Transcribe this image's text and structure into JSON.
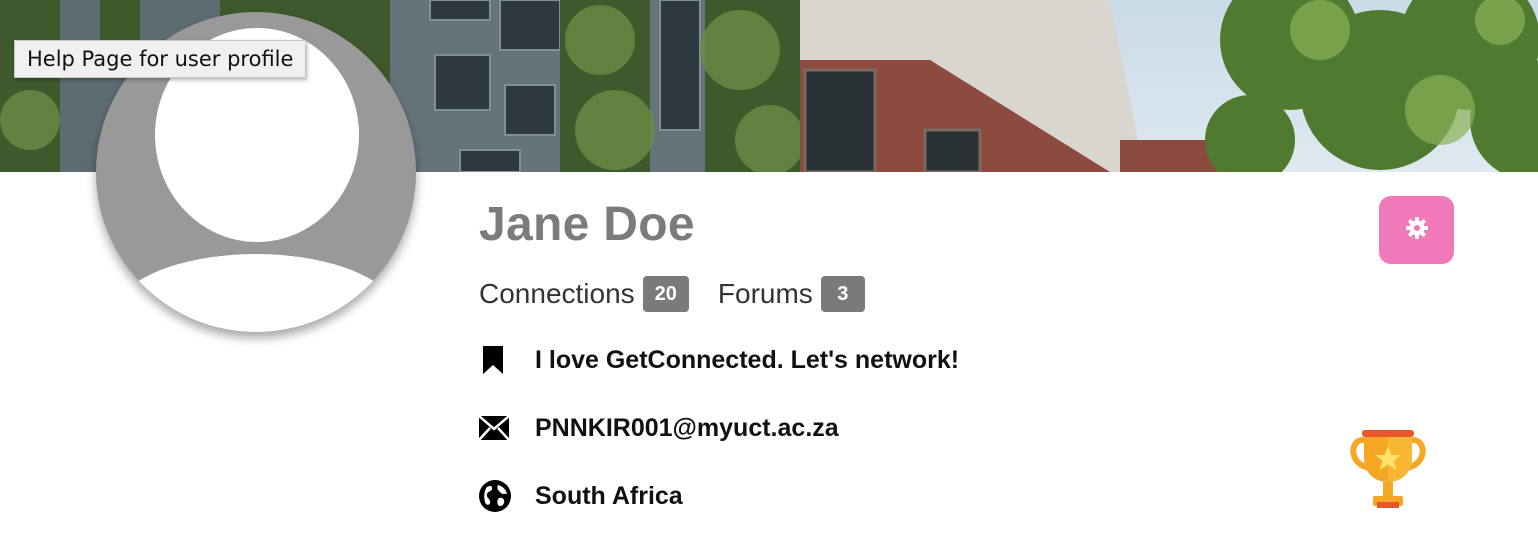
{
  "tooltip": {
    "text": "Help Page for user profile"
  },
  "profile": {
    "name": "Jane Doe",
    "stats": [
      {
        "label": "Connections",
        "count": "20"
      },
      {
        "label": "Forums",
        "count": "3"
      }
    ],
    "status": "I love GetConnected. Let's network!",
    "email": "PNNKIR001@myuct.ac.za",
    "country": "South Africa"
  },
  "colors": {
    "settings_button": "#f07ab9",
    "badge": "#7a7a7a",
    "name": "#7b7b7b",
    "avatar": "#999999"
  },
  "icons": {
    "status": "bookmark-icon",
    "email": "envelope-icon",
    "country": "globe-icon",
    "settings": "gear-icon",
    "award": "trophy-icon"
  }
}
